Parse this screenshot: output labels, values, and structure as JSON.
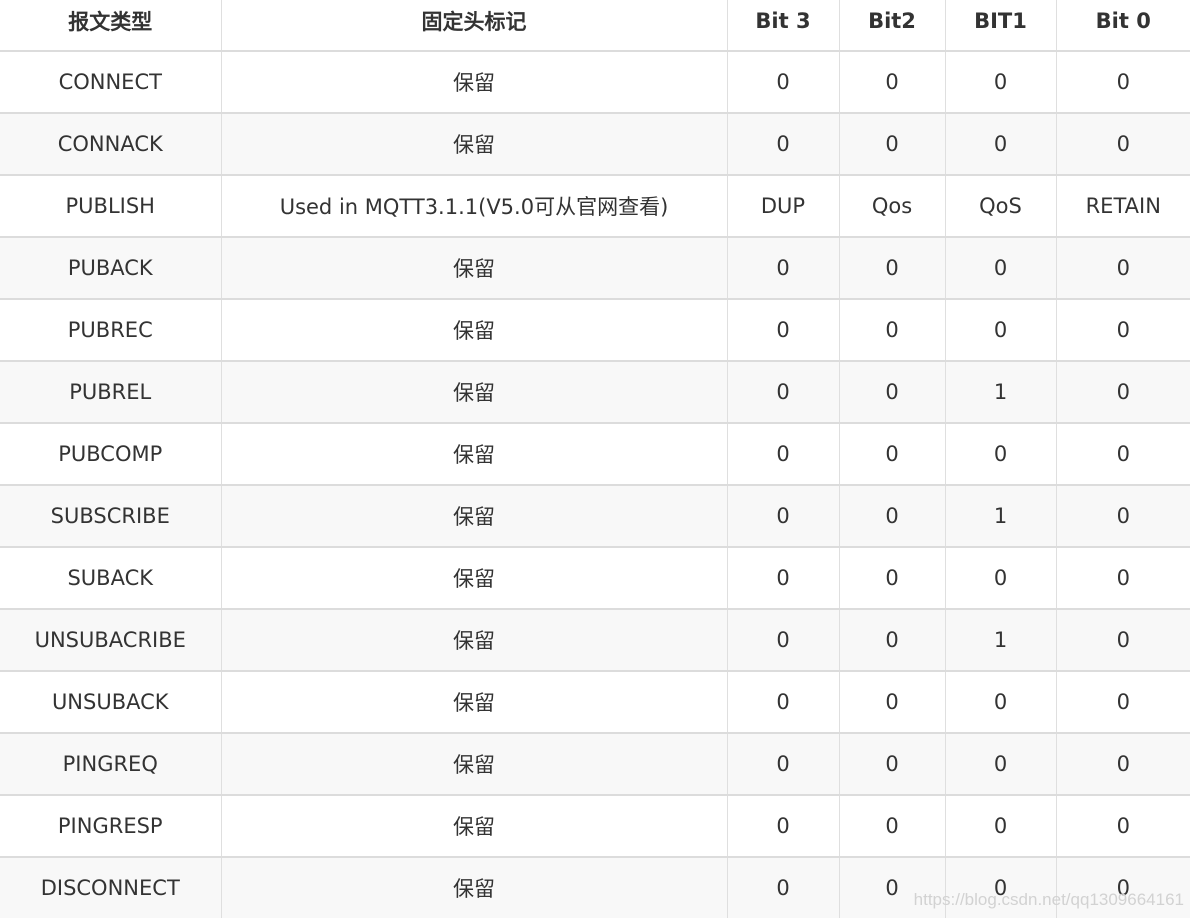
{
  "table": {
    "headers": [
      "报文类型",
      "固定头标记",
      "Bit 3",
      "Bit2",
      "BIT1",
      "Bit 0"
    ],
    "rows": [
      [
        "CONNECT",
        "保留",
        "0",
        "0",
        "0",
        "0"
      ],
      [
        "CONNACK",
        "保留",
        "0",
        "0",
        "0",
        "0"
      ],
      [
        "PUBLISH",
        "Used in MQTT3.1.1(V5.0可从官网查看)",
        "DUP",
        "Qos",
        "QoS",
        "RETAIN"
      ],
      [
        "PUBACK",
        "保留",
        "0",
        "0",
        "0",
        "0"
      ],
      [
        "PUBREC",
        "保留",
        "0",
        "0",
        "0",
        "0"
      ],
      [
        "PUBREL",
        "保留",
        "0",
        "0",
        "1",
        "0"
      ],
      [
        "PUBCOMP",
        "保留",
        "0",
        "0",
        "0",
        "0"
      ],
      [
        "SUBSCRIBE",
        "保留",
        "0",
        "0",
        "1",
        "0"
      ],
      [
        "SUBACK",
        "保留",
        "0",
        "0",
        "0",
        "0"
      ],
      [
        "UNSUBACRIBE",
        "保留",
        "0",
        "0",
        "1",
        "0"
      ],
      [
        "UNSUBACK",
        "保留",
        "0",
        "0",
        "0",
        "0"
      ],
      [
        "PINGREQ",
        "保留",
        "0",
        "0",
        "0",
        "0"
      ],
      [
        "PINGRESP",
        "保留",
        "0",
        "0",
        "0",
        "0"
      ],
      [
        "DISCONNECT",
        "保留",
        "0",
        "0",
        "0",
        "0"
      ]
    ]
  },
  "watermark": "https://blog.csdn.net/qq1309664161",
  "colors": {
    "text": "#333333",
    "grid": "#dcdcdc",
    "row_alt_bg": "#f8f8f8",
    "watermark": "#d2d2d2"
  }
}
